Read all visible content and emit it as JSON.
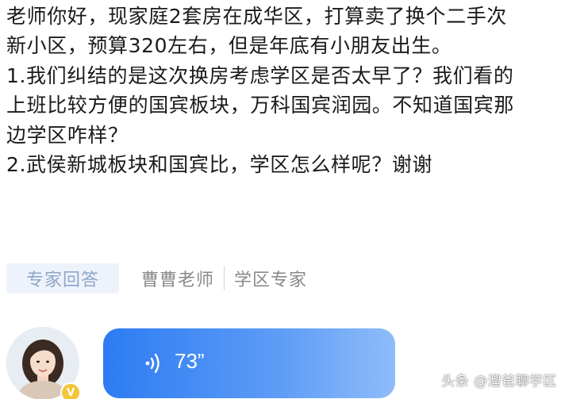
{
  "question": {
    "lines": [
      "老师你好，现家庭2套房在成华区，打算卖了换个二手次",
      "新小区，预算320左右，但是年底有小朋友出生。",
      "1.我们纠结的是这次换房考虑学区是否太早了？我们看的",
      "上班比较方便的国宾板块，万科国宾润园。不知道国宾那",
      "边学区咋样？",
      "2.武侯新城板块和国宾比，学区怎么样呢？谢谢"
    ]
  },
  "answer_meta": {
    "tag": "专家回答",
    "name": "曹曹老师",
    "role": "学区专家"
  },
  "voice": {
    "icon": "sound-wave-icon",
    "duration": "73”"
  },
  "watermark": "头条 @溜爸聊学区",
  "colors": {
    "voice_bubble_start": "#2d7bf3",
    "voice_bubble_end": "#8fbcf9",
    "tag_bg": "#eef3fb",
    "tag_text": "#8fa6c8",
    "meta_text": "#8a8a8a",
    "badge": "#f3c63a"
  }
}
